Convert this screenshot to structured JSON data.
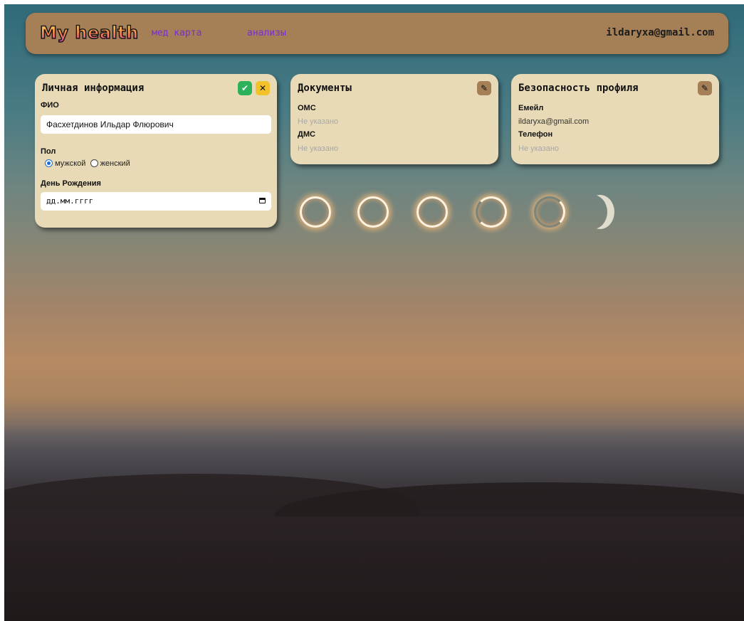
{
  "header": {
    "logo": "My health",
    "nav": [
      "мед карта",
      "анализы"
    ],
    "user_email": "ildaryxa@gmail.com"
  },
  "personal": {
    "title": "Личная информация",
    "fio_label": "ФИО",
    "fio_value": "Фасхетдинов Ильдар Флюрович",
    "gender_label": "Пол",
    "gender_options": [
      "мужской",
      "женский"
    ],
    "gender_selected": "мужской",
    "birthday_label": "День Рождения",
    "birthday_placeholder": "дд.мм.гггг"
  },
  "documents": {
    "title": "Документы",
    "oms_label": "ОМС",
    "oms_value": "Не указано",
    "dms_label": "ДМС",
    "dms_value": "Не указано"
  },
  "security": {
    "title": "Безопасность профиля",
    "email_label": "Емейл",
    "email_value": "ildaryxa@gmail.com",
    "phone_label": "Телефон",
    "phone_value": "Не указано"
  },
  "icons": {
    "edit": "pencil-icon",
    "save": "check-icon",
    "cancel": "close-icon",
    "calendar": "calendar-icon"
  },
  "colors": {
    "header_bg": "#a57f55",
    "card_bg": "#e8dab6",
    "nav_link": "#7b2fc8",
    "save_btn": "#2bb25a",
    "cancel_btn": "#f2c22a"
  }
}
